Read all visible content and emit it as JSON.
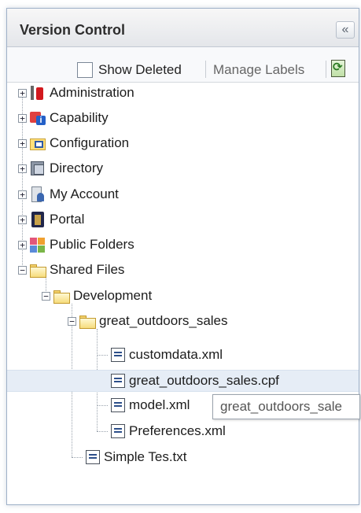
{
  "panel": {
    "title": "Version Control",
    "collapse_glyph": "«"
  },
  "toolbar": {
    "show_deleted_label": "Show Deleted",
    "show_deleted_checked": false,
    "manage_labels_label": "Manage Labels"
  },
  "tree": {
    "items": [
      {
        "label": "Administration",
        "icon": "administration-icon",
        "expander": "+"
      },
      {
        "label": "Capability",
        "icon": "capability-icon",
        "expander": "+"
      },
      {
        "label": "Configuration",
        "icon": "configuration-icon",
        "expander": "+"
      },
      {
        "label": "Directory",
        "icon": "directory-icon",
        "expander": "+"
      },
      {
        "label": "My Account",
        "icon": "my-account-icon",
        "expander": "+"
      },
      {
        "label": "Portal",
        "icon": "portal-icon",
        "expander": "+"
      },
      {
        "label": "Public Folders",
        "icon": "public-folders-icon",
        "expander": "+"
      },
      {
        "label": "Shared Files",
        "icon": "folder-icon",
        "expander": "−"
      },
      {
        "label": "Development",
        "icon": "folder-icon",
        "expander": "−"
      },
      {
        "label": "great_outdoors_sales",
        "icon": "folder-icon",
        "expander": "−"
      },
      {
        "label": "customdata.xml",
        "icon": "file-icon"
      },
      {
        "label": "great_outdoors_sales.cpf",
        "icon": "file-icon",
        "selected": true
      },
      {
        "label": "model.xml",
        "icon": "file-icon"
      },
      {
        "label": "Preferences.xml",
        "icon": "file-icon"
      },
      {
        "label": "Simple Tes.txt",
        "icon": "file-icon"
      }
    ]
  },
  "tooltip": {
    "text": "great_outdoors_sale"
  },
  "colors": {
    "selection": "#e6edf6",
    "panel_border": "#9fb1c8"
  }
}
